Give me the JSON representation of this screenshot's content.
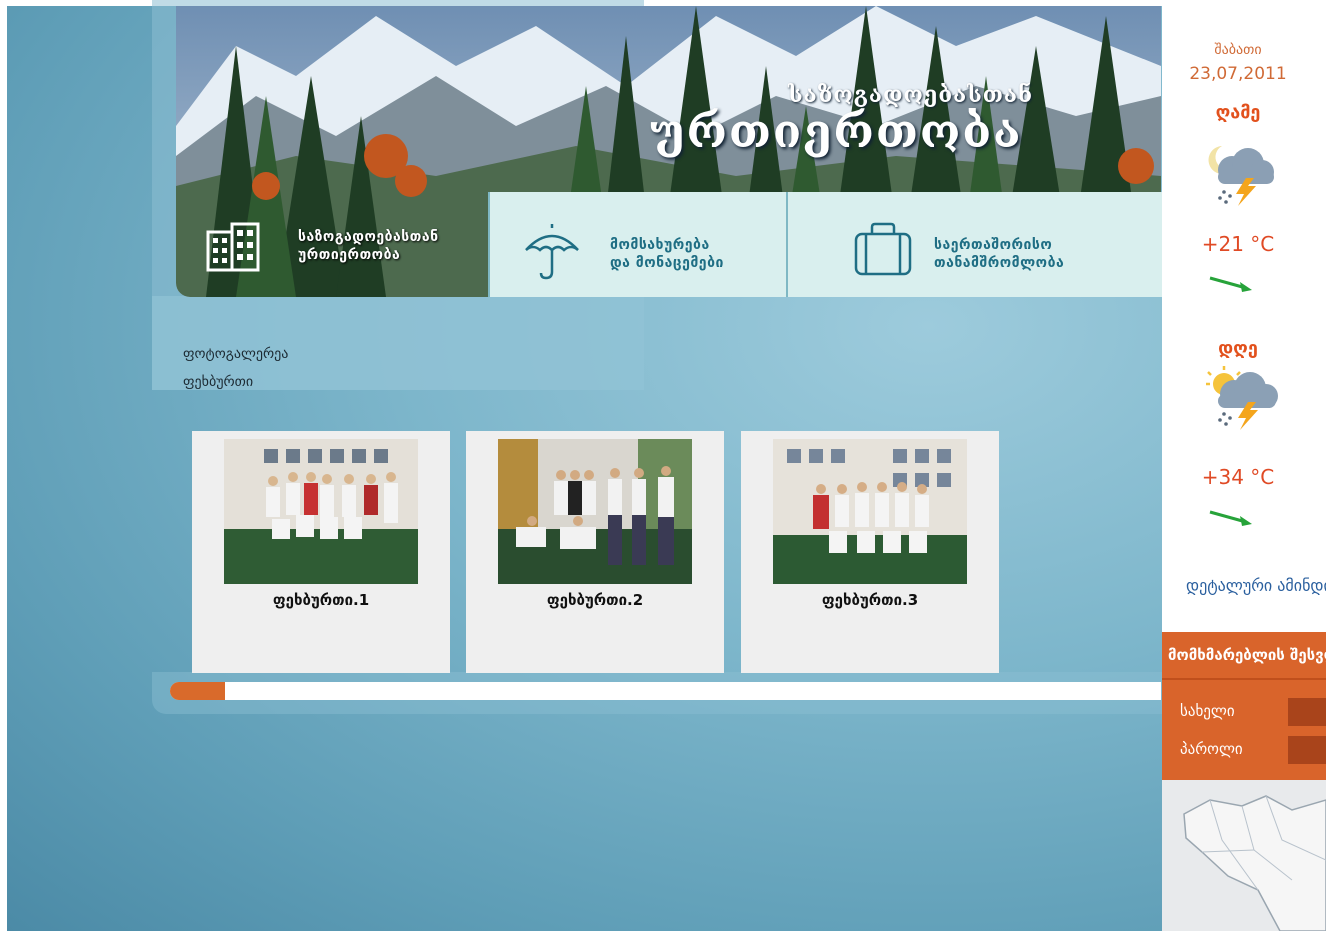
{
  "banner": {
    "subtitle": "საზოგადოებასთან",
    "title": "ურთიერთობა"
  },
  "logo": {
    "line1": "საზოგადოებასთან",
    "line2": "ურთიერთობა"
  },
  "nav": [
    {
      "line1": "მომსახურება",
      "line2": "და მონაცემები",
      "icon": "umbrella-icon"
    },
    {
      "line1": "საერთაშორისო",
      "line2": "თანამშრომლობა",
      "icon": "suitcase-icon"
    }
  ],
  "breadcrumb": {
    "section": "ფოტოგალერეა",
    "page": "ფეხბურთი"
  },
  "gallery": [
    {
      "caption": "ფეხბურთი.1"
    },
    {
      "caption": "ფეხბურთი.2"
    },
    {
      "caption": "ფეხბურთი.3"
    }
  ],
  "progress": {
    "fraction": 0.055,
    "color": "#d96a2b"
  },
  "weather": {
    "day_name": "შაბათი",
    "date": "23,07,2011",
    "night": {
      "label": "ღამე",
      "temp": "+21 °C",
      "icon": "thunderstorm-icon"
    },
    "day": {
      "label": "დღე",
      "temp": "+34 °C",
      "icon": "sun-thunderstorm-icon"
    },
    "more_link": "დეტალური ამინდი"
  },
  "users": {
    "title": "მომხმარებლის შესვლა",
    "name_label": "სახელი",
    "password_label": "პაროლი"
  },
  "colors": {
    "accent_orange": "#d9642b",
    "nav_text": "#1f6e84",
    "weather_text": "#e04a25"
  }
}
